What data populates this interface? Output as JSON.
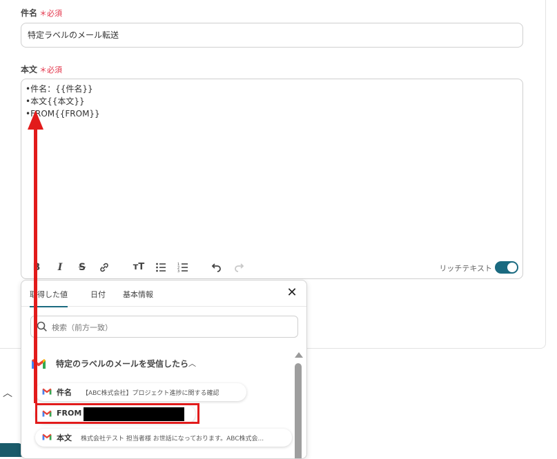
{
  "subject": {
    "label": "件名",
    "required": "＊必須",
    "value": "特定ラベルのメール転送"
  },
  "body": {
    "label": "本文",
    "required": "＊必須",
    "lines": [
      "•件名：{{件名}}",
      "•本文{{本文}}",
      "•FROM{{FROM}}"
    ]
  },
  "toolbar": {
    "rich_text_label": "リッチテキスト",
    "rich_text_on": true
  },
  "popup": {
    "tabs": [
      "取得した値",
      "日付",
      "基本情報"
    ],
    "search_placeholder": "検索（前方一致）",
    "group_title": "特定のラベルのメールを受信したら",
    "items": [
      {
        "name": "件名",
        "value": "【ABC株式会社】プロジェクト進捗に関する確認"
      },
      {
        "name": "FROM",
        "value": ""
      },
      {
        "name": "本文",
        "value": "株式会社テスト 担当者様 お世話になっております。ABC株式会..."
      }
    ]
  },
  "colors": {
    "accent": "#1a6a80",
    "required": "#e3344a",
    "annotation": "#e21b1b"
  }
}
